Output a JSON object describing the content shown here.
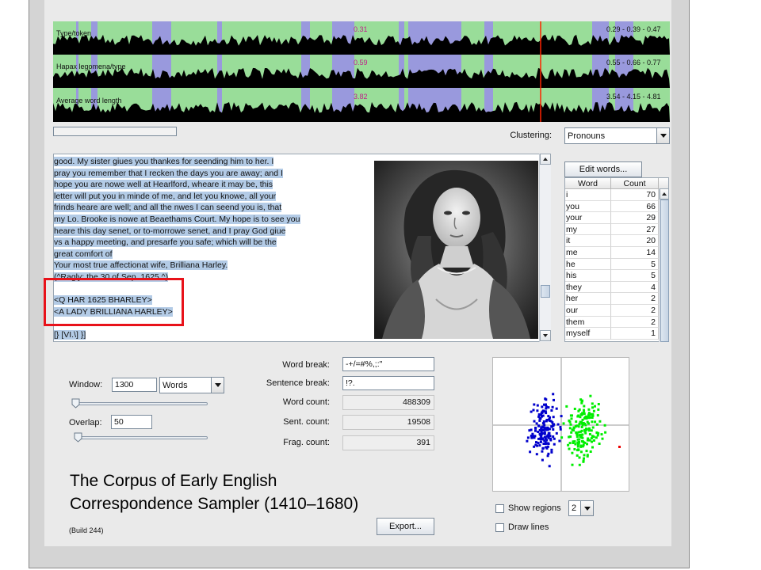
{
  "charts": {
    "tracks": [
      {
        "label": "Type/token",
        "mid_value": "0.31",
        "range": "0.29 - 0.39 - 0.47"
      },
      {
        "label": "Hapax legomena/type",
        "mid_value": "0.59",
        "range": "0.55 - 0.66 - 0.77"
      },
      {
        "label": "Average word length",
        "mid_value": "3.82",
        "range": "3.54 - 4.15 - 4.81"
      }
    ],
    "colors": {
      "cluster_a": "#9999dd",
      "cluster_b": "#99dd99",
      "trace": "#000000",
      "marker": "#ff2200"
    }
  },
  "clustering": {
    "label": "Clustering:",
    "selected": "Pronouns"
  },
  "text": {
    "lines": [
      "good. My sister giues you thankes for seending him to her. I",
      "pray you remember that I recken the days you are away; and I",
      "hope you are nowe well at Hearlford, wheare it may be, this",
      "letter will put you in minde of me, and let you knowe, all your",
      "frinds heare are well; and all the nwes I can seend you is, that",
      "my Lo. Brooke is nowe at Beaethams Court. My hope is to see you",
      "heare this day senet, or to-morrowe senet, and I pray God giue",
      "vs a happy meeting, and presarfe you safe; which will be the",
      "great comfort of",
      "  Your most true affectionat wife, Brilliana Harley.",
      "(^Ragly: the 30 of Sep. 1625.^)",
      "",
      "<Q HAR 1625 BHARLEY>",
      "<A LADY BRILLIANA HARLEY>",
      "",
      "[} [VI.\\] }]"
    ]
  },
  "word_table": {
    "edit_button": "Edit words...",
    "columns": [
      "Word",
      "Count"
    ],
    "rows": [
      {
        "word": "i",
        "count": "70"
      },
      {
        "word": "you",
        "count": "66"
      },
      {
        "word": "your",
        "count": "29"
      },
      {
        "word": "my",
        "count": "27"
      },
      {
        "word": "it",
        "count": "20"
      },
      {
        "word": "me",
        "count": "14"
      },
      {
        "word": "he",
        "count": "5"
      },
      {
        "word": "his",
        "count": "5"
      },
      {
        "word": "they",
        "count": "4"
      },
      {
        "word": "her",
        "count": "2"
      },
      {
        "word": "our",
        "count": "2"
      },
      {
        "word": "them",
        "count": "2"
      },
      {
        "word": "myself",
        "count": "1"
      }
    ]
  },
  "controls": {
    "window_label": "Window:",
    "window_value": "1300",
    "window_unit": "Words",
    "overlap_label": "Overlap:",
    "overlap_value": "50",
    "word_break_label": "Word break:",
    "word_break_value": "-+/=#%,;:\"",
    "sentence_break_label": "Sentence break:",
    "sentence_break_value": "!?.",
    "word_count_label": "Word count:",
    "word_count": "488309",
    "sent_count_label": "Sent. count:",
    "sent_count": "19508",
    "frag_count_label": "Frag. count:",
    "frag_count": "391",
    "show_regions_label": "Show regions",
    "regions_value": "2",
    "draw_lines_label": "Draw lines",
    "export_button": "Export...",
    "build": "(Build 244)"
  },
  "overlay_title": {
    "line1": "The Corpus of Early English",
    "line2": "Correspondence Sampler (1410–1680)"
  },
  "scatter": {
    "colors": {
      "cluster_a": "#0000cc",
      "cluster_b": "#00ee00",
      "marker": "#ee0000"
    }
  }
}
